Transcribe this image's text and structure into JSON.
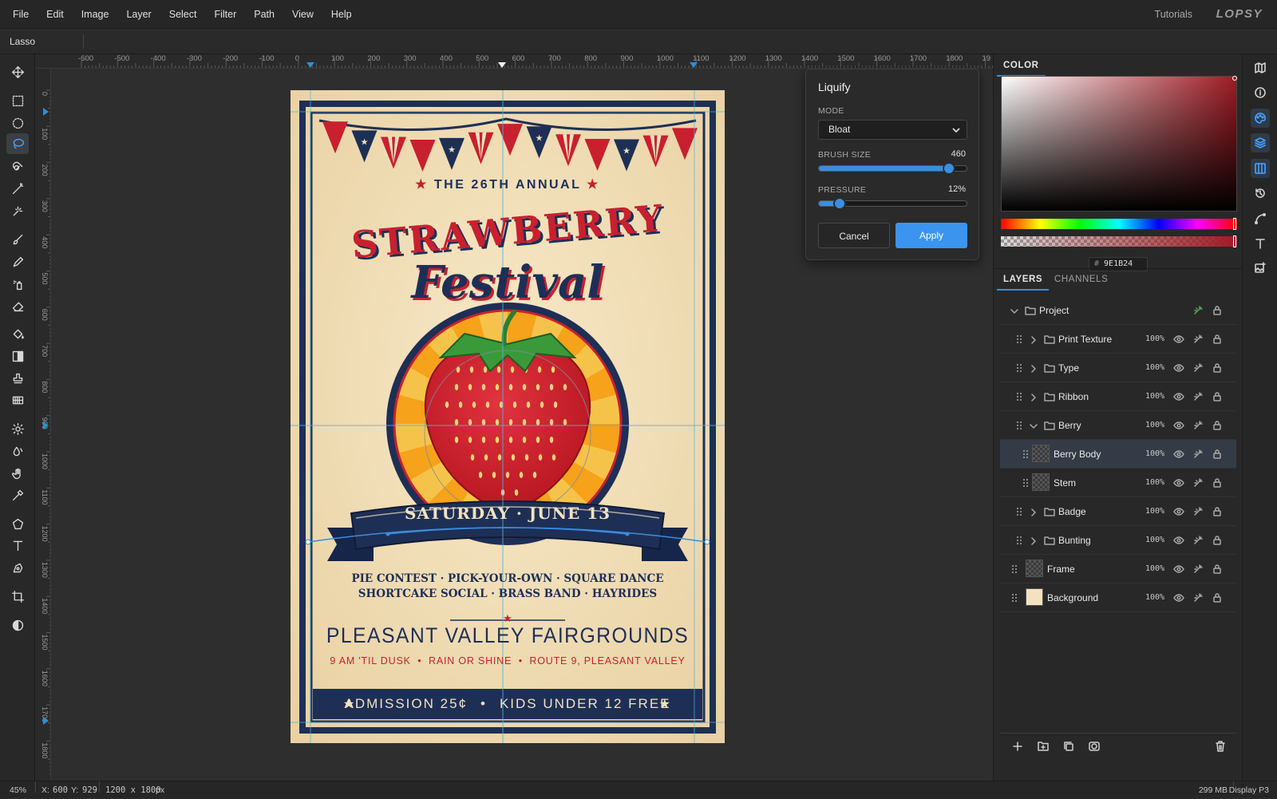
{
  "menubar": {
    "items": [
      "File",
      "Edit",
      "Image",
      "Layer",
      "Select",
      "Filter",
      "Path",
      "View",
      "Help"
    ],
    "tutorials": "Tutorials",
    "brand": "LOPSY"
  },
  "options_bar": {
    "tool_name": "Lasso"
  },
  "toolbar": {
    "active_tool": "lasso-tool",
    "tools": [
      "move-tool",
      "rect-marquee-tool",
      "ellipse-marquee-tool",
      "lasso-tool",
      "quick-select-tool",
      "magic-wand-tool",
      "spot-heal-tool",
      "brush-tool",
      "pencil-tool",
      "spray-tool",
      "eraser-tool",
      "paint-bucket-tool",
      "gradient-tool",
      "clone-stamp-tool",
      "pattern-tool",
      "dodge-tool",
      "blur-tool",
      "smudge-tool",
      "eyedropper-tool",
      "shape-tool",
      "text-tool",
      "pen-tool",
      "crop-tool",
      "contrast-tool"
    ]
  },
  "rulers": {
    "top": [
      "-600",
      "-500",
      "-400",
      "-300",
      "-200",
      "-100",
      "0",
      "100",
      "200",
      "300",
      "400",
      "500",
      "600",
      "700",
      "800",
      "900",
      "1000",
      "1100",
      "1200",
      "1300",
      "1400",
      "1500",
      "1600",
      "1700",
      "1800",
      "19"
    ],
    "left": [
      "0",
      "100",
      "200",
      "300",
      "400",
      "500",
      "600",
      "700",
      "800",
      "900",
      "1000",
      "1100",
      "1200",
      "1300",
      "1400",
      "1500",
      "1600",
      "1700",
      "1800"
    ]
  },
  "poster": {
    "annual": "THE 26TH ANNUAL",
    "title_1": "STRAWBERRY",
    "title_2": "Festival",
    "date_ribbon": "SATURDAY · JUNE 13",
    "events_1": "PIE CONTEST · PICK-YOUR-OWN · SQUARE DANCE",
    "events_2": "SHORTCAKE SOCIAL · BRASS BAND · HAYRIDES",
    "venue": "PLEASANT VALLEY FAIRGROUNDS",
    "details": "9 AM 'TIL DUSK  •  RAIN OR SHINE  •  ROUTE 9, PLEASANT VALLEY",
    "admission": "ADMISSION 25¢",
    "kids": "KIDS UNDER 12 FREE",
    "bullet": "•",
    "star": "★",
    "colors": {
      "paper": "#f3e2bf",
      "navy": "#1e2f56",
      "red": "#c8202e",
      "orange": "#f6a21a"
    }
  },
  "liquify": {
    "title": "Liquify",
    "mode_label": "MODE",
    "mode_value": "Bloat",
    "brush_size_label": "BRUSH SIZE",
    "brush_size_value": "460",
    "brush_size_fraction": 0.88,
    "pressure_label": "PRESSURE",
    "pressure_value": "12%",
    "pressure_fraction": 0.12,
    "cancel": "Cancel",
    "apply": "Apply"
  },
  "color_panel": {
    "tab": "COLOR",
    "hex_prefix": "#",
    "hex": "9E1B24",
    "color": "#9e1b24"
  },
  "layers_panel": {
    "tabs": [
      "LAYERS",
      "CHANNELS"
    ],
    "project": "Project",
    "layers": [
      {
        "name": "Print Texture",
        "opacity": "100%",
        "type": "folder",
        "expanded": false
      },
      {
        "name": "Type",
        "opacity": "100%",
        "type": "folder",
        "expanded": false
      },
      {
        "name": "Ribbon",
        "opacity": "100%",
        "type": "folder",
        "expanded": false
      },
      {
        "name": "Berry",
        "opacity": "100%",
        "type": "folder",
        "expanded": true
      },
      {
        "name": "Berry Body",
        "opacity": "100%",
        "type": "layer",
        "selected": true
      },
      {
        "name": "Stem",
        "opacity": "100%",
        "type": "layer"
      },
      {
        "name": "Badge",
        "opacity": "100%",
        "type": "folder",
        "expanded": false
      },
      {
        "name": "Bunting",
        "opacity": "100%",
        "type": "folder",
        "expanded": false
      },
      {
        "name": "Frame",
        "opacity": "100%",
        "type": "layer"
      },
      {
        "name": "Background",
        "opacity": "100%",
        "type": "layer"
      }
    ]
  },
  "status": {
    "zoom": "45%",
    "x_label": "X:",
    "x_value": "600",
    "y_label": "Y:",
    "y_value": "929",
    "doc_size": "1200 x 1800",
    "doc_unit": "px",
    "memory": "299 MB",
    "color_profile": "Display P3"
  }
}
